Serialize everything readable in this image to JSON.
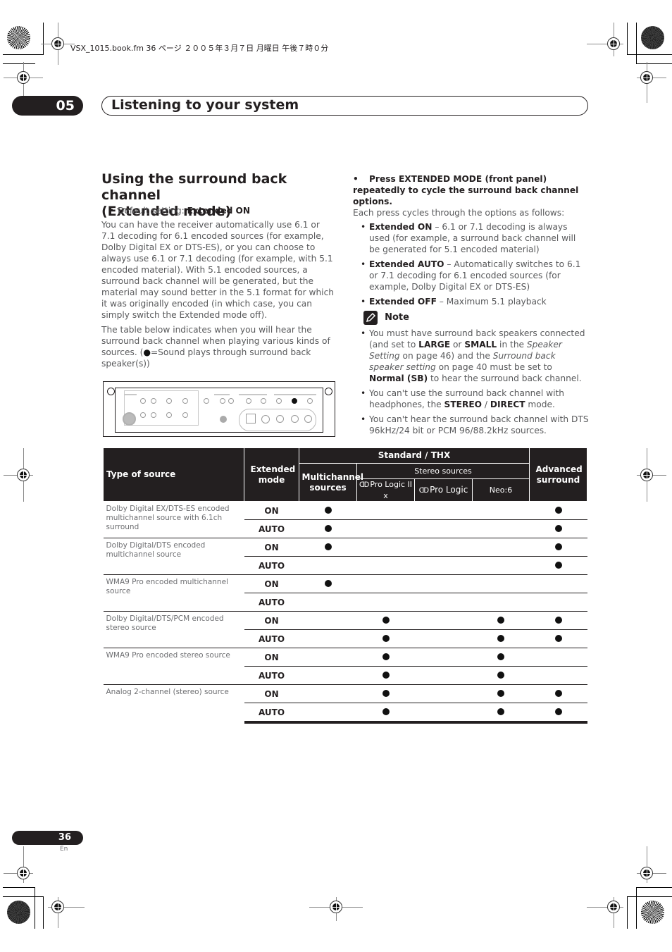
{
  "file_header": "VSX_1015.book.fm  36 ページ  ２００５年３月７日  月曜日  午後７時０分",
  "chapter": {
    "number": "05",
    "title": "Listening to your system"
  },
  "section": {
    "heading_line1": "Using the surround back channel",
    "heading_line2": "(Extended mode)",
    "default_setting_label": "Default setting: ",
    "default_setting_value": "Extended ON",
    "para1": "You can have the receiver automatically use 6.1 or 7.1 decoding for 6.1 encoded sources (for example, Dolby Digital EX or DTS-ES), or you can choose to always use 6.1 or 7.1 decoding (for example, with 5.1 encoded material). With 5.1 encoded sources, a surround back channel will be generated, but the material may sound better in the 5.1 format for which it was originally encoded (in which case, you can simply switch the Extended mode off).",
    "para2_before": "The table below indicates when you will hear the surround back channel when playing various kinds of sources. (",
    "para2_symbol": "●",
    "para2_after": "=Sound plays through surround back speaker(s))"
  },
  "instruction": {
    "step": "Press EXTENDED MODE (front panel) repeatedly to cycle the surround back channel options.",
    "intro": "Each press cycles through the options as follows:",
    "options": [
      {
        "name": "Extended ON",
        "desc": " – 6.1 or 7.1 decoding is always used (for example, a surround back channel will be generated for 5.1 encoded material)"
      },
      {
        "name": "Extended AUTO",
        "desc": " – Automatically switches to 6.1 or 7.1 decoding for 6.1 encoded sources (for example, Dolby Digital EX or DTS-ES)"
      },
      {
        "name": "Extended OFF",
        "desc": " – Maximum 5.1 playback"
      }
    ]
  },
  "note": {
    "title": "Note",
    "items": [
      {
        "parts": [
          {
            "t": "You must have surround back speakers connected (and set to ",
            "s": "n"
          },
          {
            "t": "LARGE",
            "s": "b"
          },
          {
            "t": " or ",
            "s": "n"
          },
          {
            "t": "SMALL",
            "s": "b"
          },
          {
            "t": " in the ",
            "s": "n"
          },
          {
            "t": "Speaker Setting",
            "s": "i"
          },
          {
            "t": " on page 46) and the ",
            "s": "n"
          },
          {
            "t": "Surround back speaker setting",
            "s": "i"
          },
          {
            "t": " on page 40 must be set to ",
            "s": "n"
          },
          {
            "t": "Normal (SB)",
            "s": "b"
          },
          {
            "t": " to hear the surround back channel.",
            "s": "n"
          }
        ]
      },
      {
        "parts": [
          {
            "t": "You can't use the surround back channel with headphones, the ",
            "s": "n"
          },
          {
            "t": "STEREO",
            "s": "b"
          },
          {
            "t": " / ",
            "s": "n"
          },
          {
            "t": "DIRECT",
            "s": "b"
          },
          {
            "t": " mode.",
            "s": "n"
          }
        ]
      },
      {
        "parts": [
          {
            "t": "You can't hear the surround back channel with DTS 96kHz/24 bit or PCM 96/88.2kHz sources.",
            "s": "n"
          }
        ]
      }
    ]
  },
  "table": {
    "headers": {
      "type_of_source": "Type of source",
      "extended_mode": "Extended mode",
      "standard_thx": "Standard / THX",
      "multichannel_sources": "Multichannel sources",
      "stereo_sources": "Stereo sources",
      "pro_logic_iix": "Pro Logic II x",
      "pro_logic": "Pro Logic",
      "dolby_symbol": "ᗡᗞ",
      "neo6": "Neo:6",
      "advanced_surround": "Advanced surround"
    },
    "dot_symbol": "●",
    "groups": [
      {
        "source": "Dolby Digital EX/DTS-ES encoded multichannel source with 6.1ch surround",
        "rows": [
          {
            "mode": "ON",
            "multichannel": true,
            "pl2x": false,
            "pl": false,
            "neo6": false,
            "advanced": true
          },
          {
            "mode": "AUTO",
            "multichannel": true,
            "pl2x": false,
            "pl": false,
            "neo6": false,
            "advanced": true
          }
        ]
      },
      {
        "source": "Dolby Digital/DTS encoded multichannel source",
        "rows": [
          {
            "mode": "ON",
            "multichannel": true,
            "pl2x": false,
            "pl": false,
            "neo6": false,
            "advanced": true
          },
          {
            "mode": "AUTO",
            "multichannel": false,
            "pl2x": false,
            "pl": false,
            "neo6": false,
            "advanced": true
          }
        ]
      },
      {
        "source": "WMA9 Pro encoded multichannel source",
        "rows": [
          {
            "mode": "ON",
            "multichannel": true,
            "pl2x": false,
            "pl": false,
            "neo6": false,
            "advanced": false
          },
          {
            "mode": "AUTO",
            "multichannel": false,
            "pl2x": false,
            "pl": false,
            "neo6": false,
            "advanced": false
          }
        ]
      },
      {
        "source": "Dolby Digital/DTS/PCM encoded stereo source",
        "rows": [
          {
            "mode": "ON",
            "multichannel": false,
            "pl2x": true,
            "pl": false,
            "neo6": true,
            "advanced": true
          },
          {
            "mode": "AUTO",
            "multichannel": false,
            "pl2x": true,
            "pl": false,
            "neo6": true,
            "advanced": true
          }
        ]
      },
      {
        "source": "WMA9 Pro encoded stereo source",
        "rows": [
          {
            "mode": "ON",
            "multichannel": false,
            "pl2x": true,
            "pl": false,
            "neo6": true,
            "advanced": false
          },
          {
            "mode": "AUTO",
            "multichannel": false,
            "pl2x": true,
            "pl": false,
            "neo6": true,
            "advanced": false
          }
        ]
      },
      {
        "source": "Analog 2-channel (stereo) source",
        "rows": [
          {
            "mode": "ON",
            "multichannel": false,
            "pl2x": true,
            "pl": false,
            "neo6": true,
            "advanced": true
          },
          {
            "mode": "AUTO",
            "multichannel": false,
            "pl2x": true,
            "pl": false,
            "neo6": true,
            "advanced": true
          }
        ]
      }
    ]
  },
  "footer": {
    "page_number": "36",
    "language": "En"
  }
}
